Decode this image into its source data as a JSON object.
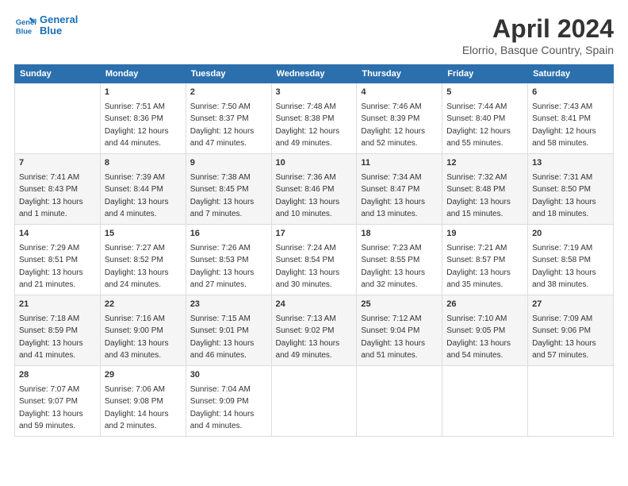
{
  "app": {
    "logo_line1": "General",
    "logo_line2": "Blue"
  },
  "title": "April 2024",
  "location": "Elorrio, Basque Country, Spain",
  "days_of_week": [
    "Sunday",
    "Monday",
    "Tuesday",
    "Wednesday",
    "Thursday",
    "Friday",
    "Saturday"
  ],
  "weeks": [
    [
      {
        "day": "",
        "info": ""
      },
      {
        "day": "1",
        "info": "Sunrise: 7:51 AM\nSunset: 8:36 PM\nDaylight: 12 hours\nand 44 minutes."
      },
      {
        "day": "2",
        "info": "Sunrise: 7:50 AM\nSunset: 8:37 PM\nDaylight: 12 hours\nand 47 minutes."
      },
      {
        "day": "3",
        "info": "Sunrise: 7:48 AM\nSunset: 8:38 PM\nDaylight: 12 hours\nand 49 minutes."
      },
      {
        "day": "4",
        "info": "Sunrise: 7:46 AM\nSunset: 8:39 PM\nDaylight: 12 hours\nand 52 minutes."
      },
      {
        "day": "5",
        "info": "Sunrise: 7:44 AM\nSunset: 8:40 PM\nDaylight: 12 hours\nand 55 minutes."
      },
      {
        "day": "6",
        "info": "Sunrise: 7:43 AM\nSunset: 8:41 PM\nDaylight: 12 hours\nand 58 minutes."
      }
    ],
    [
      {
        "day": "7",
        "info": "Sunrise: 7:41 AM\nSunset: 8:43 PM\nDaylight: 13 hours\nand 1 minute."
      },
      {
        "day": "8",
        "info": "Sunrise: 7:39 AM\nSunset: 8:44 PM\nDaylight: 13 hours\nand 4 minutes."
      },
      {
        "day": "9",
        "info": "Sunrise: 7:38 AM\nSunset: 8:45 PM\nDaylight: 13 hours\nand 7 minutes."
      },
      {
        "day": "10",
        "info": "Sunrise: 7:36 AM\nSunset: 8:46 PM\nDaylight: 13 hours\nand 10 minutes."
      },
      {
        "day": "11",
        "info": "Sunrise: 7:34 AM\nSunset: 8:47 PM\nDaylight: 13 hours\nand 13 minutes."
      },
      {
        "day": "12",
        "info": "Sunrise: 7:32 AM\nSunset: 8:48 PM\nDaylight: 13 hours\nand 15 minutes."
      },
      {
        "day": "13",
        "info": "Sunrise: 7:31 AM\nSunset: 8:50 PM\nDaylight: 13 hours\nand 18 minutes."
      }
    ],
    [
      {
        "day": "14",
        "info": "Sunrise: 7:29 AM\nSunset: 8:51 PM\nDaylight: 13 hours\nand 21 minutes."
      },
      {
        "day": "15",
        "info": "Sunrise: 7:27 AM\nSunset: 8:52 PM\nDaylight: 13 hours\nand 24 minutes."
      },
      {
        "day": "16",
        "info": "Sunrise: 7:26 AM\nSunset: 8:53 PM\nDaylight: 13 hours\nand 27 minutes."
      },
      {
        "day": "17",
        "info": "Sunrise: 7:24 AM\nSunset: 8:54 PM\nDaylight: 13 hours\nand 30 minutes."
      },
      {
        "day": "18",
        "info": "Sunrise: 7:23 AM\nSunset: 8:55 PM\nDaylight: 13 hours\nand 32 minutes."
      },
      {
        "day": "19",
        "info": "Sunrise: 7:21 AM\nSunset: 8:57 PM\nDaylight: 13 hours\nand 35 minutes."
      },
      {
        "day": "20",
        "info": "Sunrise: 7:19 AM\nSunset: 8:58 PM\nDaylight: 13 hours\nand 38 minutes."
      }
    ],
    [
      {
        "day": "21",
        "info": "Sunrise: 7:18 AM\nSunset: 8:59 PM\nDaylight: 13 hours\nand 41 minutes."
      },
      {
        "day": "22",
        "info": "Sunrise: 7:16 AM\nSunset: 9:00 PM\nDaylight: 13 hours\nand 43 minutes."
      },
      {
        "day": "23",
        "info": "Sunrise: 7:15 AM\nSunset: 9:01 PM\nDaylight: 13 hours\nand 46 minutes."
      },
      {
        "day": "24",
        "info": "Sunrise: 7:13 AM\nSunset: 9:02 PM\nDaylight: 13 hours\nand 49 minutes."
      },
      {
        "day": "25",
        "info": "Sunrise: 7:12 AM\nSunset: 9:04 PM\nDaylight: 13 hours\nand 51 minutes."
      },
      {
        "day": "26",
        "info": "Sunrise: 7:10 AM\nSunset: 9:05 PM\nDaylight: 13 hours\nand 54 minutes."
      },
      {
        "day": "27",
        "info": "Sunrise: 7:09 AM\nSunset: 9:06 PM\nDaylight: 13 hours\nand 57 minutes."
      }
    ],
    [
      {
        "day": "28",
        "info": "Sunrise: 7:07 AM\nSunset: 9:07 PM\nDaylight: 13 hours\nand 59 minutes."
      },
      {
        "day": "29",
        "info": "Sunrise: 7:06 AM\nSunset: 9:08 PM\nDaylight: 14 hours\nand 2 minutes."
      },
      {
        "day": "30",
        "info": "Sunrise: 7:04 AM\nSunset: 9:09 PM\nDaylight: 14 hours\nand 4 minutes."
      },
      {
        "day": "",
        "info": ""
      },
      {
        "day": "",
        "info": ""
      },
      {
        "day": "",
        "info": ""
      },
      {
        "day": "",
        "info": ""
      }
    ]
  ]
}
